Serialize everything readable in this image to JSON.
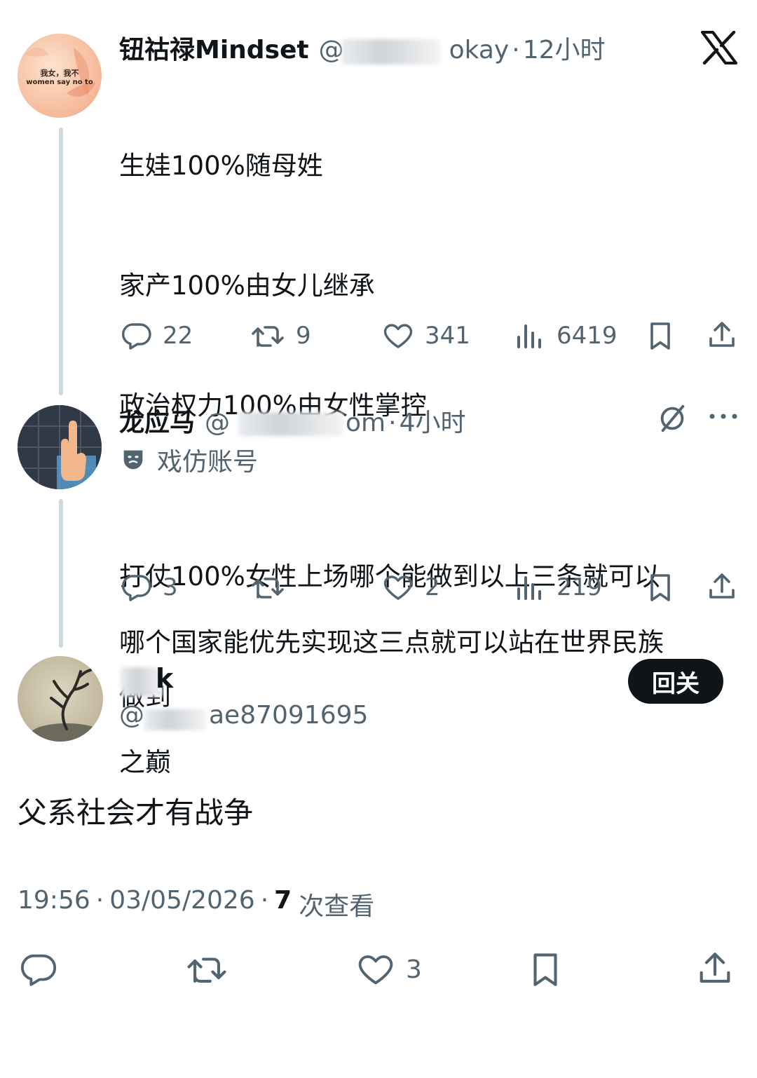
{
  "thread": [
    {
      "name": "钮祜禄Mindset",
      "handle_visible": "@",
      "handle_tail": "okay",
      "time": "12小时",
      "avatar_text_line1": "我女，我不",
      "avatar_text_line2": "women say no to",
      "lines": [
        "生娃100%随母姓",
        "家产100%由女儿继承",
        "政治权力100%由女性掌控",
        "",
        "哪个国家能优先实现这三点就可以站在世界民族",
        "之巅"
      ],
      "stats": {
        "replies": "22",
        "retweets": "9",
        "likes": "341",
        "views": "6419"
      }
    },
    {
      "name": "龙应马",
      "handle_visible": "@",
      "handle_tail": "om",
      "time": "4小时",
      "label": "戏仿账号",
      "lines": [
        "打仗100%女性上场哪个能做到以上三条就可以",
        "做到"
      ],
      "stats": {
        "replies": "3",
        "retweets": "",
        "likes": "2",
        "views": "219"
      }
    }
  ],
  "main_tweet": {
    "name_visible": "k",
    "handle_visible": "@",
    "handle_tail": "ae87091695",
    "follow_label": "回关",
    "text": "父系社会才有战争",
    "time": "19:56",
    "date": "03/05/2026",
    "views_count": "7",
    "views_label": "次查看",
    "likes": "3"
  },
  "colors": {
    "text": "#0f1419",
    "secondary": "#536471",
    "thread_line": "#cfd9de"
  }
}
